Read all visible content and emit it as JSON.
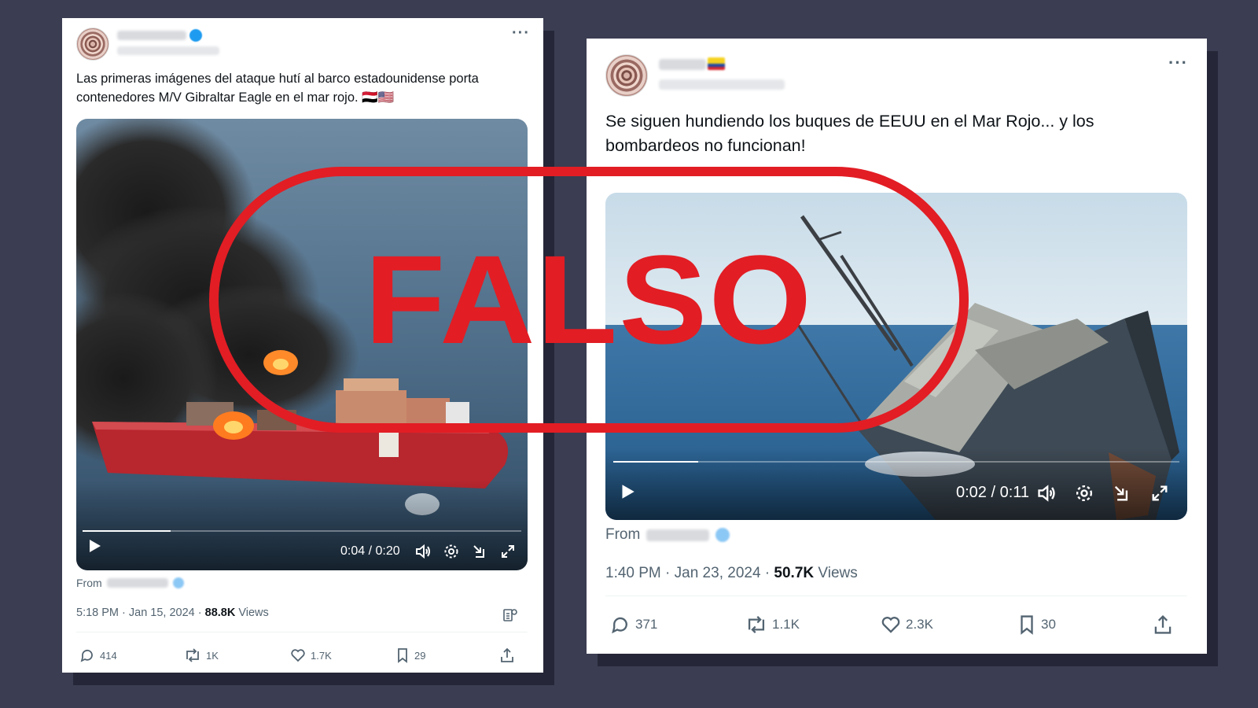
{
  "post1": {
    "text": "Las primeras imágenes del ataque hutí al barco estadounidense porta contenedores M/V Gibraltar Eagle en el mar rojo. 🇾🇪🇺🇸",
    "video": {
      "time": "0:04 / 0:20",
      "progress": 0.2
    },
    "from_label": "From",
    "timestamp": "5:18 PM · Jan 15, 2024 · ",
    "views_count": "88.8K",
    "views_label": " Views",
    "actions": {
      "replies": "414",
      "reposts": "1K",
      "likes": "1.7K",
      "bookmarks": "29"
    }
  },
  "post2": {
    "text": "Se siguen hundiendo los buques de EEUU en el Mar Rojo... y los bombardeos no funcionan!",
    "video": {
      "time": "0:02 / 0:11",
      "progress": 0.15
    },
    "from_label": "From",
    "timestamp": "1:40 PM · Jan 23, 2024 · ",
    "views_count": "50.7K",
    "views_label": " Views",
    "actions": {
      "replies": "371",
      "reposts": "1.1K",
      "likes": "2.3K",
      "bookmarks": "30"
    }
  },
  "stamp": {
    "label": "FALSO",
    "color": "#e21d24"
  },
  "icons": [
    "more-icon",
    "play-icon",
    "volume-icon",
    "settings-icon",
    "dock-icon",
    "fullscreen-icon",
    "reply-icon",
    "repost-icon",
    "like-icon",
    "bookmark-icon",
    "share-icon",
    "analytics-icon"
  ]
}
